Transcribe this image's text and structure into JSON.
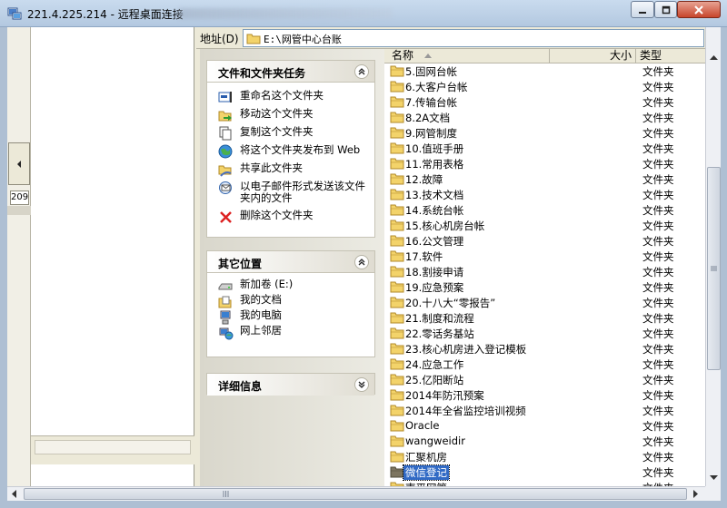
{
  "window": {
    "title": "221.4.225.214 - 远程桌面连接",
    "left_number": "209"
  },
  "address": {
    "label": "地址(D)",
    "path": "E:\\网管中心台账"
  },
  "tasks_panel": {
    "title": "文件和文件夹任务",
    "items": [
      {
        "label": "重命名这个文件夹",
        "icon": "rename-icon"
      },
      {
        "label": "移动这个文件夹",
        "icon": "move-icon"
      },
      {
        "label": "复制这个文件夹",
        "icon": "copy-icon"
      },
      {
        "label": "将这个文件夹发布到 Web",
        "icon": "publish-web-icon"
      },
      {
        "label": "共享此文件夹",
        "icon": "share-icon"
      },
      {
        "label": "以电子邮件形式发送该文件夹内的文件",
        "icon": "email-icon"
      },
      {
        "label": "删除这个文件夹",
        "icon": "delete-icon"
      }
    ]
  },
  "other_places": {
    "title": "其它位置",
    "items": [
      {
        "label": "新加卷 (E:)",
        "icon": "drive-icon"
      },
      {
        "label": "我的文档",
        "icon": "my-documents-icon"
      },
      {
        "label": "我的电脑",
        "icon": "my-computer-icon"
      },
      {
        "label": "网上邻居",
        "icon": "network-icon"
      }
    ]
  },
  "details": {
    "title": "详细信息"
  },
  "columns": {
    "name": "名称",
    "size": "大小",
    "type": "类型"
  },
  "files": [
    {
      "name": "5.固网台帐",
      "type": "文件夹"
    },
    {
      "name": "6.大客户台帐",
      "type": "文件夹"
    },
    {
      "name": "7.传输台帐",
      "type": "文件夹"
    },
    {
      "name": "8.2A文档",
      "type": "文件夹"
    },
    {
      "name": "9.网管制度",
      "type": "文件夹"
    },
    {
      "name": "10.值班手册",
      "type": "文件夹"
    },
    {
      "name": "11.常用表格",
      "type": "文件夹"
    },
    {
      "name": "12.故障",
      "type": "文件夹"
    },
    {
      "name": "13.技术文档",
      "type": "文件夹"
    },
    {
      "name": "14.系统台帐",
      "type": "文件夹"
    },
    {
      "name": "15.核心机房台帐",
      "type": "文件夹"
    },
    {
      "name": "16.公文管理",
      "type": "文件夹"
    },
    {
      "name": "17.软件",
      "type": "文件夹"
    },
    {
      "name": "18.割接申请",
      "type": "文件夹"
    },
    {
      "name": "19.应急预案",
      "type": "文件夹"
    },
    {
      "name": "20.十八大“零报告”",
      "type": "文件夹"
    },
    {
      "name": "21.制度和流程",
      "type": "文件夹"
    },
    {
      "name": "22.零话务基站",
      "type": "文件夹"
    },
    {
      "name": "23.核心机房进入登记模板",
      "type": "文件夹"
    },
    {
      "name": "24.应急工作",
      "type": "文件夹"
    },
    {
      "name": "25.亿阳断站",
      "type": "文件夹"
    },
    {
      "name": "2014年防汛预案",
      "type": "文件夹"
    },
    {
      "name": "2014年全省监控培训视频",
      "type": "文件夹"
    },
    {
      "name": "Oracle",
      "type": "文件夹"
    },
    {
      "name": "wangweidir",
      "type": "文件夹"
    },
    {
      "name": "汇聚机房",
      "type": "文件夹"
    },
    {
      "name": "微信登记",
      "type": "文件夹",
      "selected": true
    },
    {
      "name": "南平网管",
      "type": "文件夹"
    }
  ]
}
